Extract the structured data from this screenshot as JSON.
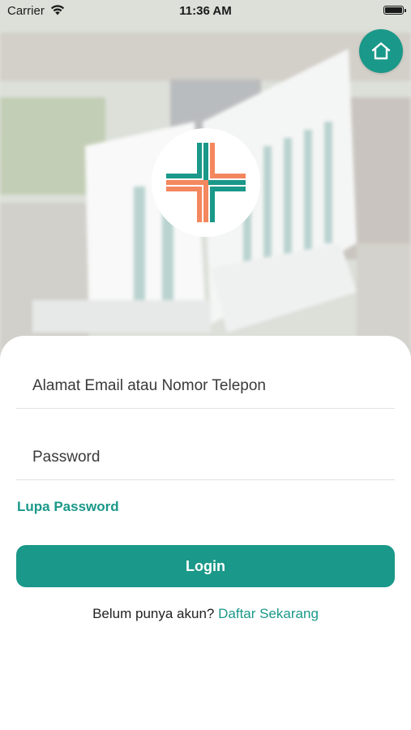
{
  "status_bar": {
    "carrier": "Carrier",
    "time": "11:36 AM"
  },
  "colors": {
    "accent": "#1a9889",
    "logo_teal": "#1a9889",
    "logo_orange": "#f4875e"
  },
  "icons": {
    "home": "home-icon",
    "wifi": "wifi-icon",
    "battery": "battery-icon",
    "logo": "hospital-cross-logo"
  },
  "login_form": {
    "email_placeholder": "Alamat Email atau Nomor Telepon",
    "password_placeholder": "Password",
    "forgot_password": "Lupa Password",
    "login_button": "Login",
    "register_prompt": "Belum punya akun?",
    "register_link": "Daftar Sekarang"
  }
}
